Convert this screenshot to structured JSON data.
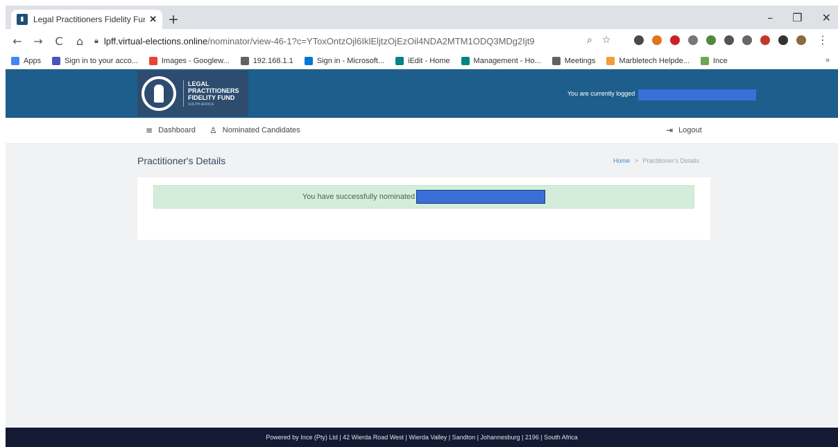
{
  "browser": {
    "tab_title": "Legal Practitioners Fidelity Fund",
    "tab_close": "✕",
    "new_tab": "+",
    "window_controls": [
      "–",
      "❐",
      "✕"
    ],
    "nav": {
      "back": "←",
      "forward": "→",
      "reload": "C",
      "home": "⌂"
    },
    "url_host": "lpff.virtual-elections.online",
    "url_path": "/nominator/view-46-1?c=YToxOntzOjl6IklEljtzOjEzOil4NDA2MTM1ODQ3MDg2Ijt9",
    "omnibox_icons": [
      "search-icon",
      "star-icon"
    ],
    "extension_colors": [
      "#4a4a4a",
      "#e8711c",
      "#cb2027",
      "#777777",
      "#4f8a3a",
      "#555555",
      "#666666",
      "#c0392b",
      "#333333",
      "#8b6b3d"
    ],
    "bookmarks": [
      {
        "label": "Apps",
        "color": "#4285f4"
      },
      {
        "label": "Sign in to your acco...",
        "color": "#4b53bc"
      },
      {
        "label": "Images - Googlew...",
        "color": "#ea4335"
      },
      {
        "label": "192.168.1.1",
        "color": "#5f6368"
      },
      {
        "label": "Sign in - Microsoft...",
        "color": "#0078d4"
      },
      {
        "label": "iEdit - Home",
        "color": "#038387"
      },
      {
        "label": "Management - Ho...",
        "color": "#038387"
      },
      {
        "label": "Meetings",
        "color": "#5f6368"
      },
      {
        "label": "Marbletech Helpde...",
        "color": "#f29d38"
      },
      {
        "label": "Ince",
        "color": "#6aa84f"
      }
    ],
    "bookmarks_more": "»"
  },
  "site": {
    "logo": {
      "line1": "LEGAL",
      "line2": "PRACTITIONERS",
      "line3": "FIDELITY FUND",
      "line4": "SOUTH AFRICA"
    },
    "logged_in_text": "You are currently logged",
    "nav": {
      "dashboard": "Dashboard",
      "candidates": "Nominated Candidates",
      "logout": "Logout"
    },
    "page_title": "Practitioner's Details",
    "breadcrumb": {
      "home": "Home",
      "sep": ">",
      "current": "Practitioner's Details"
    },
    "alert": "You have successfully nominated",
    "footer": "Powered by Ince (Pty) Ltd | 42 Wierda Road West | Wierda Valley | Sandton | Johannesburg | 2196 | South Africa"
  }
}
